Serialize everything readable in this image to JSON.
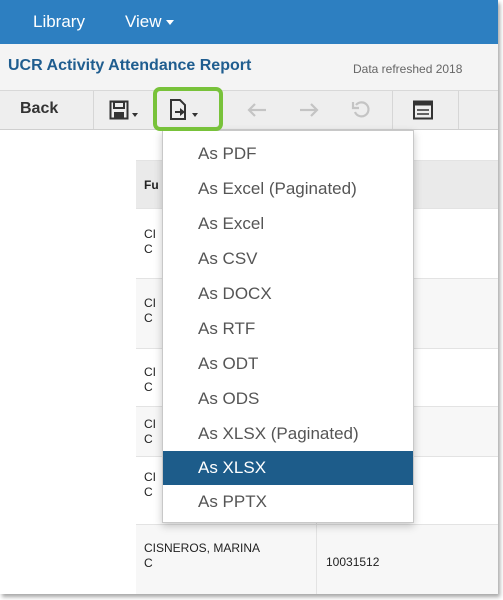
{
  "nav": {
    "library": "Library",
    "view": "View"
  },
  "report": {
    "title": "UCR Activity Attendance Report",
    "refresh": "Data refreshed 2018"
  },
  "toolbar": {
    "back": "Back"
  },
  "table": {
    "header": {
      "col1": "Fu",
      "col2": ")"
    },
    "rows": [
      {
        "name_line1": "CI",
        "name_line2": "C"
      },
      {
        "name_line1": "CI",
        "name_line2": "C"
      },
      {
        "name_line1": "CI",
        "name_line2": "C"
      },
      {
        "name_line1": "CI",
        "name_line2": "C"
      },
      {
        "name_line1": "CI",
        "name_line2": "C"
      },
      {
        "name_line1": "CISNEROS, MARINA",
        "name_line2": "C",
        "id": "10031512"
      }
    ]
  },
  "export_menu": {
    "items": [
      "As PDF",
      "As Excel (Paginated)",
      "As Excel",
      "As CSV",
      "As DOCX",
      "As RTF",
      "As ODT",
      "As ODS",
      "As XLSX (Paginated)",
      "As XLSX",
      "As PPTX"
    ],
    "selected": "As XLSX"
  },
  "colors": {
    "nav_bg": "#2d7fc1",
    "title": "#1f5d8f",
    "highlight": "#78c23a",
    "selected_bg": "#1d5c8a"
  }
}
